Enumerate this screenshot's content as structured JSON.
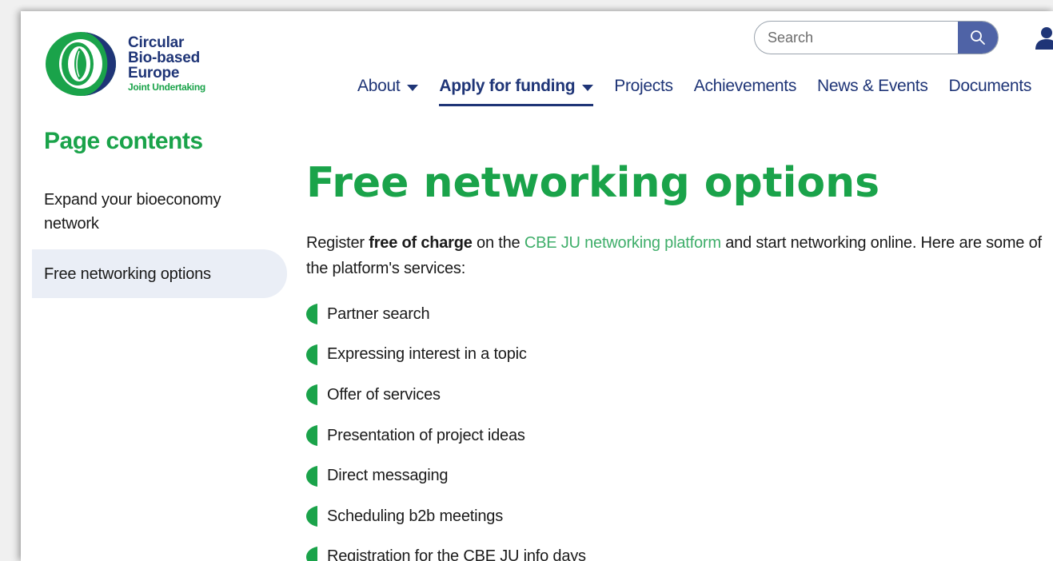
{
  "header": {
    "logo": {
      "line1": "Circular",
      "line2": "Bio-based",
      "line3": "Europe",
      "sub": "Joint Undertaking"
    },
    "search": {
      "placeholder": "Search"
    },
    "nav": [
      {
        "label": "About",
        "has_dropdown": true
      },
      {
        "label": "Apply for funding",
        "has_dropdown": true,
        "active": true
      },
      {
        "label": "Projects"
      },
      {
        "label": "Achievements"
      },
      {
        "label": "News & Events"
      },
      {
        "label": "Documents"
      }
    ]
  },
  "sidebar": {
    "title": "Page contents",
    "items": [
      {
        "label": "Expand your bioeconomy network"
      },
      {
        "label": "Free networking options",
        "active": true
      }
    ]
  },
  "main": {
    "title": "Free networking options",
    "intro": {
      "part1": "Register ",
      "bold": "free of charge",
      "part2": " on the ",
      "link": "CBE JU networking platform",
      "part3": " and start networking online. Here are some of the platform's services:"
    },
    "bullets": [
      "Partner search",
      "Expressing interest in a topic",
      "Offer of services",
      "Presentation of project ideas",
      "Direct messaging",
      "Scheduling b2b meetings",
      "Registration for the CBE JU info days"
    ]
  },
  "colors": {
    "brand_green": "#1aa34a",
    "brand_navy": "#1f3577",
    "search_button": "#4f63a6",
    "link_green": "#3fae6a",
    "active_side_bg": "#eaeef6"
  },
  "icons": {
    "search": "magnifier-icon",
    "user": "user-icon",
    "bullet": "leaf-bullet-icon"
  }
}
